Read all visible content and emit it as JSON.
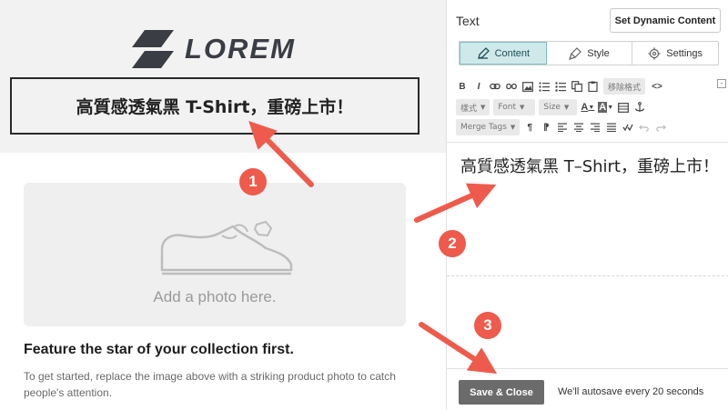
{
  "preview": {
    "logo_text": "LOREM",
    "headline": "高質感透氣黑 T-Shirt，重磅上市！",
    "photo_placeholder": "Add a photo here.",
    "feature_title": "Feature the star of your collection first.",
    "feature_body": "To get started, replace the image above with a striking product photo to catch people's attention."
  },
  "panel": {
    "title": "Text",
    "dynamic_button": "Set Dynamic Content",
    "tabs": [
      {
        "label": "Content",
        "icon": "pencil-icon",
        "active": true
      },
      {
        "label": "Style",
        "icon": "brush-icon",
        "active": false
      },
      {
        "label": "Settings",
        "icon": "gear-icon",
        "active": false
      }
    ],
    "toolbar": {
      "bold": "B",
      "italic": "I",
      "remove_format": "移除格式",
      "code": "<>",
      "collapse": "-",
      "format_dropdown": "樣式",
      "font_dropdown": "Font",
      "size_dropdown": "Size",
      "text_color": "A",
      "bg_color": "A",
      "merge_tags": "Merge Tags",
      "paragraph": "¶"
    },
    "editor_text": "高質感透氣黑 T–Shirt，重磅上市！",
    "save_button": "Save & Close",
    "autosave_note": "We'll autosave every 20 seconds"
  },
  "annotations": {
    "step1": "1",
    "step2": "2",
    "step3": "3",
    "color": "#ee5a4b"
  }
}
